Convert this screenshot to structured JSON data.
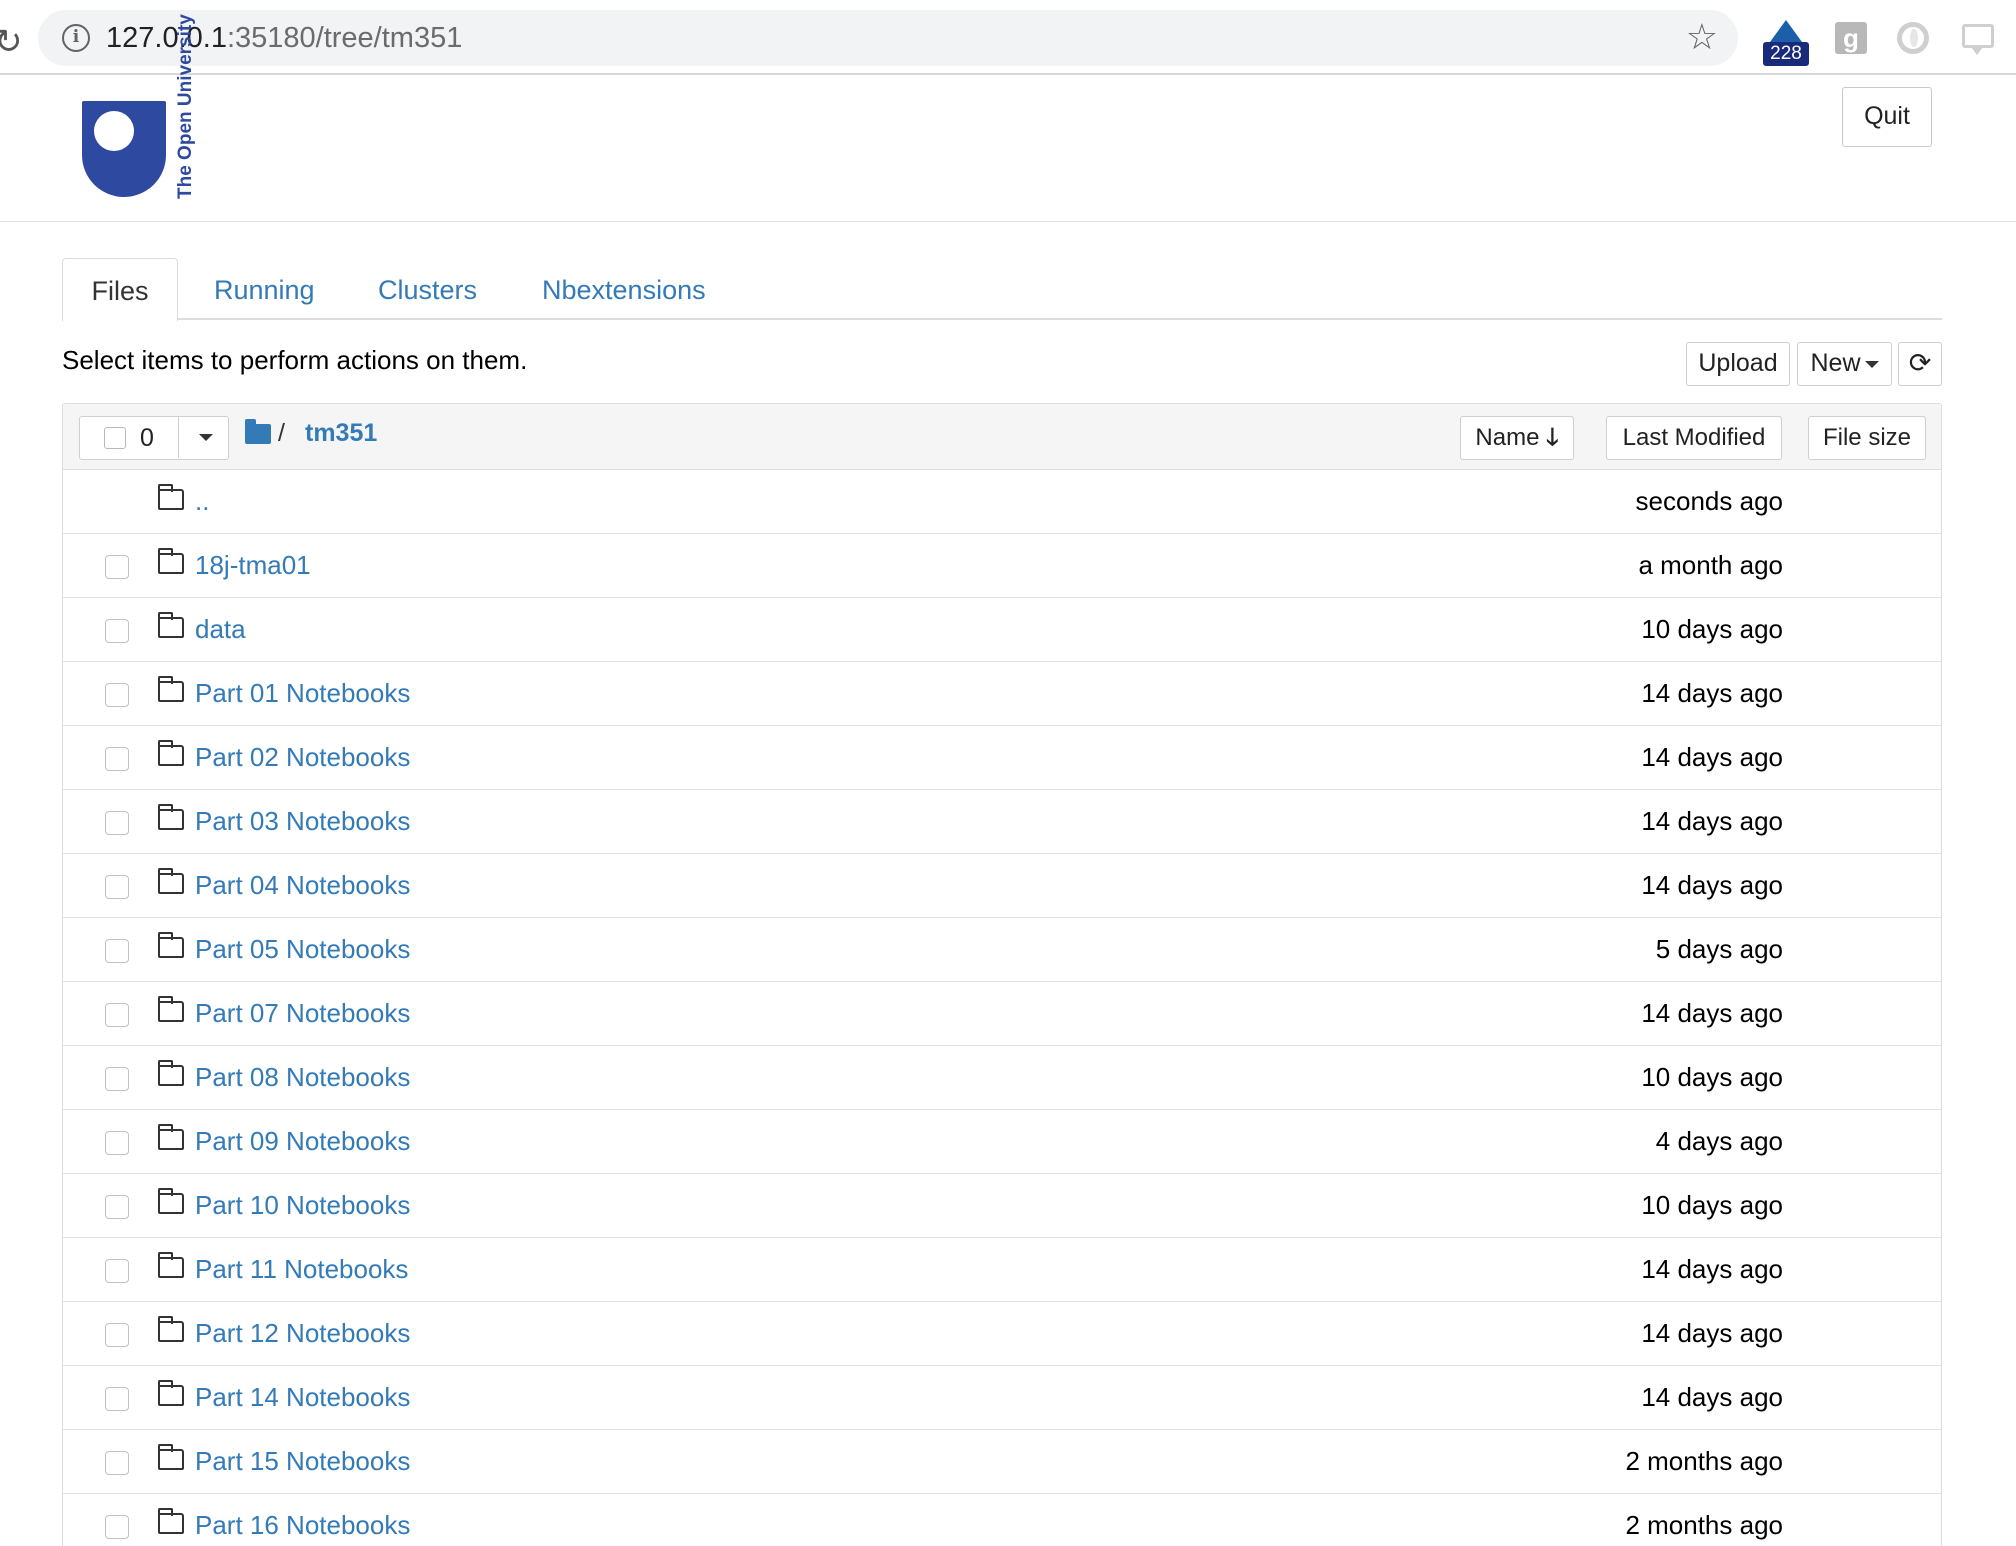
{
  "browser": {
    "url_host": "127.0.0.1",
    "url_path": ":35180/tree/tm351",
    "extension_badge": "228"
  },
  "header": {
    "logo_text": "The Open University",
    "quit_label": "Quit"
  },
  "tabs": [
    {
      "label": "Files",
      "active": true
    },
    {
      "label": "Running",
      "active": false
    },
    {
      "label": "Clusters",
      "active": false
    },
    {
      "label": "Nbextensions",
      "active": false
    }
  ],
  "toolbar": {
    "hint": "Select items to perform actions on them.",
    "upload_label": "Upload",
    "new_label": "New",
    "refresh_icon": "refresh-icon"
  },
  "listing": {
    "selected_count": "0",
    "breadcrumb_sep": "/",
    "current_dir": "tm351",
    "sort_name_label": "Name",
    "sort_modified_label": "Last Modified",
    "sort_size_label": "File size",
    "rows": [
      {
        "name": "..",
        "modified": "seconds ago",
        "checkbox": false
      },
      {
        "name": "18j-tma01",
        "modified": "a month ago",
        "checkbox": true
      },
      {
        "name": "data",
        "modified": "10 days ago",
        "checkbox": true
      },
      {
        "name": "Part 01 Notebooks",
        "modified": "14 days ago",
        "checkbox": true
      },
      {
        "name": "Part 02 Notebooks",
        "modified": "14 days ago",
        "checkbox": true
      },
      {
        "name": "Part 03 Notebooks",
        "modified": "14 days ago",
        "checkbox": true
      },
      {
        "name": "Part 04 Notebooks",
        "modified": "14 days ago",
        "checkbox": true
      },
      {
        "name": "Part 05 Notebooks",
        "modified": "5 days ago",
        "checkbox": true
      },
      {
        "name": "Part 07 Notebooks",
        "modified": "14 days ago",
        "checkbox": true
      },
      {
        "name": "Part 08 Notebooks",
        "modified": "10 days ago",
        "checkbox": true
      },
      {
        "name": "Part 09 Notebooks",
        "modified": "4 days ago",
        "checkbox": true
      },
      {
        "name": "Part 10 Notebooks",
        "modified": "10 days ago",
        "checkbox": true
      },
      {
        "name": "Part 11 Notebooks",
        "modified": "14 days ago",
        "checkbox": true
      },
      {
        "name": "Part 12 Notebooks",
        "modified": "14 days ago",
        "checkbox": true
      },
      {
        "name": "Part 14 Notebooks",
        "modified": "14 days ago",
        "checkbox": true
      },
      {
        "name": "Part 15 Notebooks",
        "modified": "2 months ago",
        "checkbox": true
      },
      {
        "name": "Part 16 Notebooks",
        "modified": "2 months ago",
        "checkbox": true
      }
    ]
  },
  "colors": {
    "link": "#337ab7",
    "ou_blue": "#2e4aa0",
    "border": "#dddddd"
  }
}
